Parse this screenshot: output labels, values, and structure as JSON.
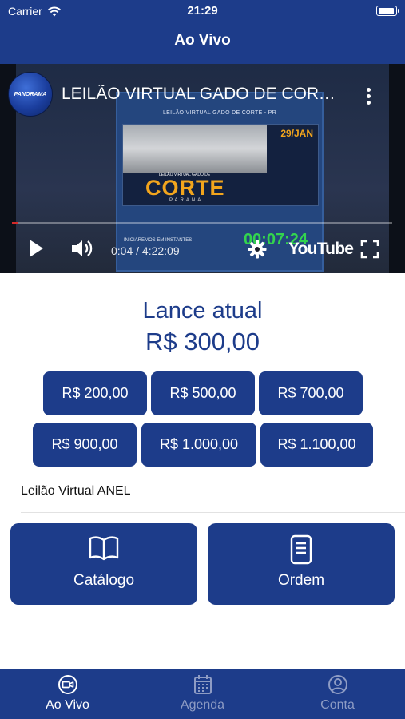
{
  "status_bar": {
    "carrier": "Carrier",
    "time": "21:29"
  },
  "header": {
    "title": "Ao Vivo"
  },
  "video": {
    "title": "LEILÃO VIRTUAL GADO DE CORTE...",
    "channel_avatar_text": "PANORAMA",
    "slide_heading": "LEILÃO VIRTUAL GADO DE CORTE - PR",
    "banner_subtitle": "LEILÃO VIRTUAL GADO DE",
    "banner_title": "CORTE",
    "banner_region": "PARANÁ",
    "banner_date": "29/JAN",
    "starting_text": "INICIAREMOS EM INSTANTES",
    "countdown": "00:07:24",
    "timecode": "0:04 / 4:22:09",
    "progress_fraction": 0.016,
    "youtube_label": "YouTube"
  },
  "bid": {
    "label": "Lance atual",
    "value": "R$ 300,00",
    "options": [
      "R$ 200,00",
      "R$ 500,00",
      "R$ 700,00",
      "R$ 900,00",
      "R$ 1.000,00",
      "R$ 1.100,00"
    ]
  },
  "auction_name": "Leilão Virtual ANEL",
  "actions": {
    "catalog": "Catálogo",
    "order": "Ordem"
  },
  "tabs": [
    {
      "label": "Ao Vivo",
      "icon": "video-camera-icon",
      "active": true
    },
    {
      "label": "Agenda",
      "icon": "calendar-icon",
      "active": false
    },
    {
      "label": "Conta",
      "icon": "user-circle-icon",
      "active": false
    }
  ],
  "colors": {
    "primary": "#1d3c8a",
    "accent_timer": "#33d44e",
    "banner_orange": "#f2a51d"
  }
}
